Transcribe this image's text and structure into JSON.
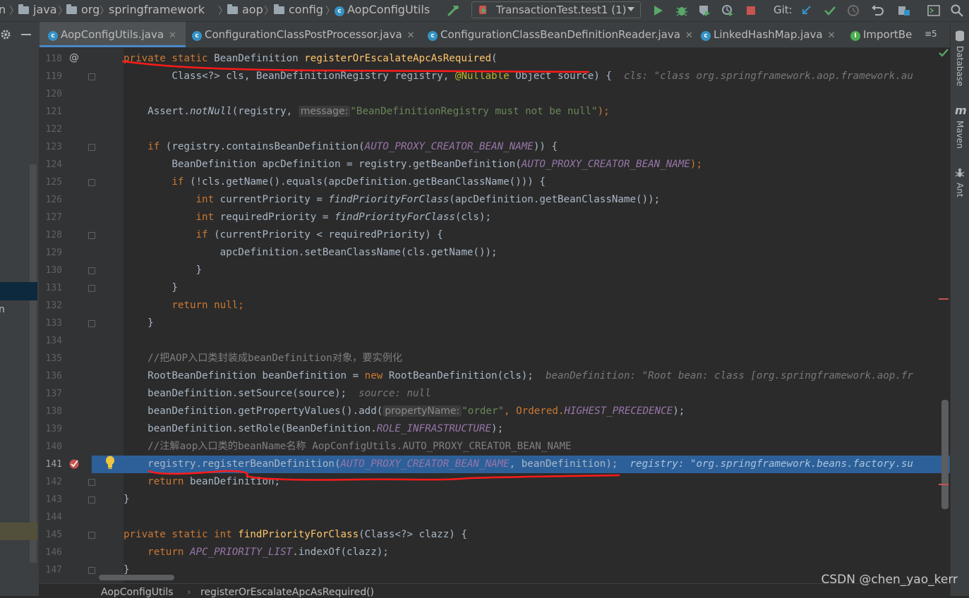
{
  "breadcrumbs": [
    "n",
    "java",
    "org",
    "springframework",
    "aop",
    "config",
    "AopConfigUtils"
  ],
  "run_config": "TransactionTest.test1 (1)",
  "git_label": "Git:",
  "tabs": [
    {
      "label": "AopConfigUtils.java",
      "active": true,
      "icon": "class-icon"
    },
    {
      "label": "ConfigurationClassPostProcessor.java",
      "active": false,
      "icon": "class-icon"
    },
    {
      "label": "ConfigurationClassBeanDefinitionReader.java",
      "active": false,
      "icon": "class-icon"
    },
    {
      "label": "LinkedHashMap.java",
      "active": false,
      "icon": "class-icon"
    },
    {
      "label": "ImportBe",
      "active": false,
      "icon": "interface-icon"
    }
  ],
  "tab_overflow": "≡5",
  "right_tools": [
    "Database",
    "Maven",
    "Ant"
  ],
  "line_numbers": [
    "118",
    "119",
    "120",
    "121",
    "122",
    "123",
    "124",
    "125",
    "126",
    "127",
    "128",
    "129",
    "130",
    "131",
    "132",
    "133",
    "134",
    "135",
    "136",
    "137",
    "138",
    "139",
    "140",
    "141",
    "142",
    "143",
    "144",
    "145",
    "146",
    "147"
  ],
  "code": {
    "l118_a": "private static ",
    "l118_b": "BeanDefinition ",
    "l118_c": "registerOrEscalateApcAsRequired",
    "l118_d": "(",
    "l119_a": "        Class<?> cls, BeanDefinitionRegistry registry, ",
    "l119_b": "@Nullable ",
    "l119_c": "Object source) {  ",
    "l119_hint": "cls: \"class org.springframework.aop.framework.au",
    "l121_a": "    Assert.",
    "l121_b": "notNull",
    "l121_c": "(registry, ",
    "l121_param": "message:",
    "l121_d": "\"BeanDefinitionRegistry must not be null\"",
    "l121_e": ");",
    "l123_a": "    if ",
    "l123_b": "(registry.containsBeanDefinition(",
    "l123_c": "AUTO_PROXY_CREATOR_BEAN_NAME",
    "l123_d": ")) {",
    "l124_a": "        BeanDefinition apcDefinition = registry.getBeanDefinition(",
    "l124_b": "AUTO_PROXY_CREATOR_BEAN_NAME",
    "l124_c": ");",
    "l125_a": "        if ",
    "l125_b": "(!cls.getName().equals(apcDefinition.getBeanClassName())) {",
    "l126_a": "            int ",
    "l126_b": "currentPriority = ",
    "l126_c": "findPriorityForClass",
    "l126_d": "(apcDefinition.getBeanClassName());",
    "l127_a": "            int ",
    "l127_b": "requiredPriority = ",
    "l127_c": "findPriorityForClass",
    "l127_d": "(cls);",
    "l128_a": "            if ",
    "l128_b": "(currentPriority < requiredPriority) {",
    "l129": "                apcDefinition.setBeanClassName(cls.getName());",
    "l130": "            }",
    "l131": "        }",
    "l132_a": "        return null",
    "l132_b": ";",
    "l133": "    }",
    "l135": "    //把AOP入口类封装成beanDefinition对象，要实例化",
    "l136_a": "    RootBeanDefinition beanDefinition = ",
    "l136_b": "new ",
    "l136_c": "RootBeanDefinition(cls);  ",
    "l136_hint": "beanDefinition: \"Root bean: class [org.springframework.aop.fr",
    "l137_a": "    beanDefinition.setSource(source);  ",
    "l137_hint": "source: null",
    "l138_a": "    beanDefinition.getPropertyValues().add(",
    "l138_param": "propertyName:",
    "l138_b": "\"order\"",
    "l138_c": ", Ordered.",
    "l138_d": "HIGHEST_PRECEDENCE",
    "l138_e": ");",
    "l139_a": "    beanDefinition.setRole(BeanDefinition.",
    "l139_b": "ROLE_INFRASTRUCTURE",
    "l139_c": ");",
    "l140": "    //注解aop入口类的beanName名称 AopConfigUtils.AUTO_PROXY_CREATOR_BEAN_NAME",
    "l141_a": "    registry.registerBeanDefinition(",
    "l141_b": "AUTO_PROXY_CREATOR_BEAN_NAME",
    "l141_c": ", beanDefinition);  ",
    "l141_hint": "registry: \"org.springframework.beans.factory.su",
    "l142_a": "    return ",
    "l142_b": "beanDefinition;",
    "l143": "}",
    "l145_a": "private static int ",
    "l145_b": "findPriorityForClass",
    "l145_c": "(Class<?> clazz) {",
    "l146_a": "    return ",
    "l146_b": "APC_PRIORITY_LIST",
    "l146_c": ".indexOf(clazz);",
    "l147": "}"
  },
  "bottom_breadcrumbs": [
    "AopConfigUtils",
    "registerOrEscalateApcAsRequired()"
  ],
  "watermark": "CSDN @chen_yao_kerr",
  "colors": {
    "keyword": "#cc7832",
    "method": "#ffc66d",
    "constant": "#9876aa",
    "string": "#6a8759",
    "highlight": "#2d6099",
    "annotation_underline": "#ff0000"
  }
}
